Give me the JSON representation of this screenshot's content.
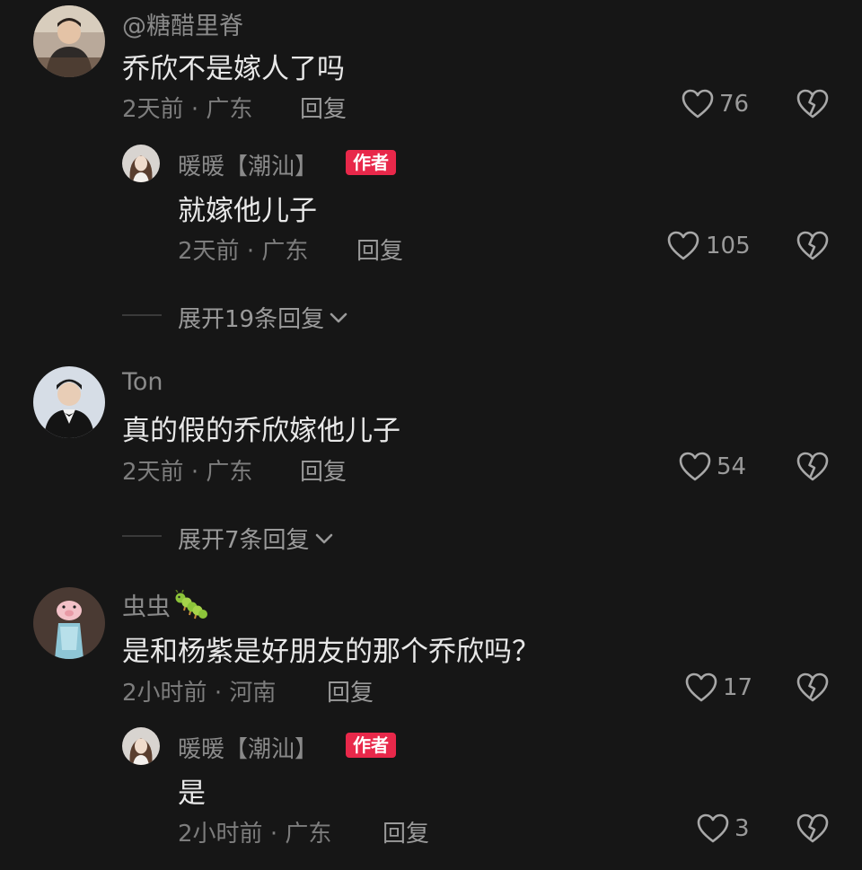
{
  "comments": [
    {
      "username": "@糖醋里脊",
      "text": "乔欣不是嫁人了吗",
      "time": "2天前",
      "location": "广东",
      "reply_label": "回复",
      "likes": "76",
      "replies": [
        {
          "username": "暖暖【潮汕】",
          "badge": "作者",
          "text": "就嫁他儿子",
          "time": "2天前",
          "location": "广东",
          "reply_label": "回复",
          "likes": "105"
        }
      ],
      "expand": "展开19条回复"
    },
    {
      "username": "Ton",
      "text": "真的假的乔欣嫁他儿子",
      "time": "2天前",
      "location": "广东",
      "reply_label": "回复",
      "likes": "54",
      "expand": "展开7条回复"
    },
    {
      "username": "虫虫",
      "text": "是和杨紫是好朋友的那个乔欣吗？",
      "time": "2小时前",
      "location": "河南",
      "reply_label": "回复",
      "likes": "17",
      "replies": [
        {
          "username": "暖暖【潮汕】",
          "badge": "作者",
          "text": "是",
          "time": "2小时前",
          "location": "广东",
          "reply_label": "回复",
          "likes": "3"
        }
      ]
    }
  ],
  "separator": "·",
  "colors": {
    "background": "#161616",
    "author_badge": "#e8284a"
  },
  "icons": {
    "like": "heart-outline-icon",
    "dislike": "broken-heart-icon",
    "expand": "chevron-down-icon",
    "username_emoji": "caterpillar-icon"
  }
}
